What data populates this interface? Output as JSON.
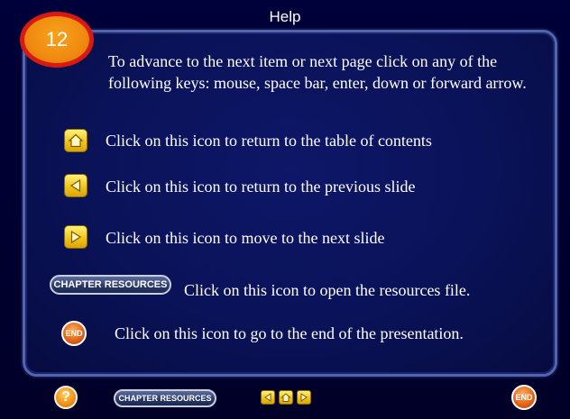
{
  "header": {
    "title": "Help"
  },
  "badge": {
    "number": "12"
  },
  "intro": {
    "text": "To advance to the next item or next page click on any of the following keys: mouse, space bar, enter, down or forward arrow."
  },
  "items": [
    {
      "icon": "home-icon",
      "text": "Click on this icon to return to the table of contents"
    },
    {
      "icon": "previous-arrow-icon",
      "text": "Click on this icon to return to the previous slide"
    },
    {
      "icon": "next-arrow-icon",
      "text": "Click on this icon to move to the next slide"
    },
    {
      "icon": "chapter-resources-button",
      "label": "CHAPTER RESOURCES",
      "text": "Click on this icon to open the resources file."
    },
    {
      "icon": "end-icon",
      "label": "END",
      "text": "Click on this icon to go to the end of the presentation."
    }
  ],
  "footer": {
    "help_label": "?",
    "resources_label": "CHAPTER RESOURCES",
    "end_label": "END"
  },
  "colors": {
    "background": "#000030",
    "panel": "#0a1258",
    "panel_border": "#5566a8",
    "badge_fill": "#f08a10",
    "badge_ring": "#d81a12",
    "icon_yellow": "#f2c51a"
  }
}
